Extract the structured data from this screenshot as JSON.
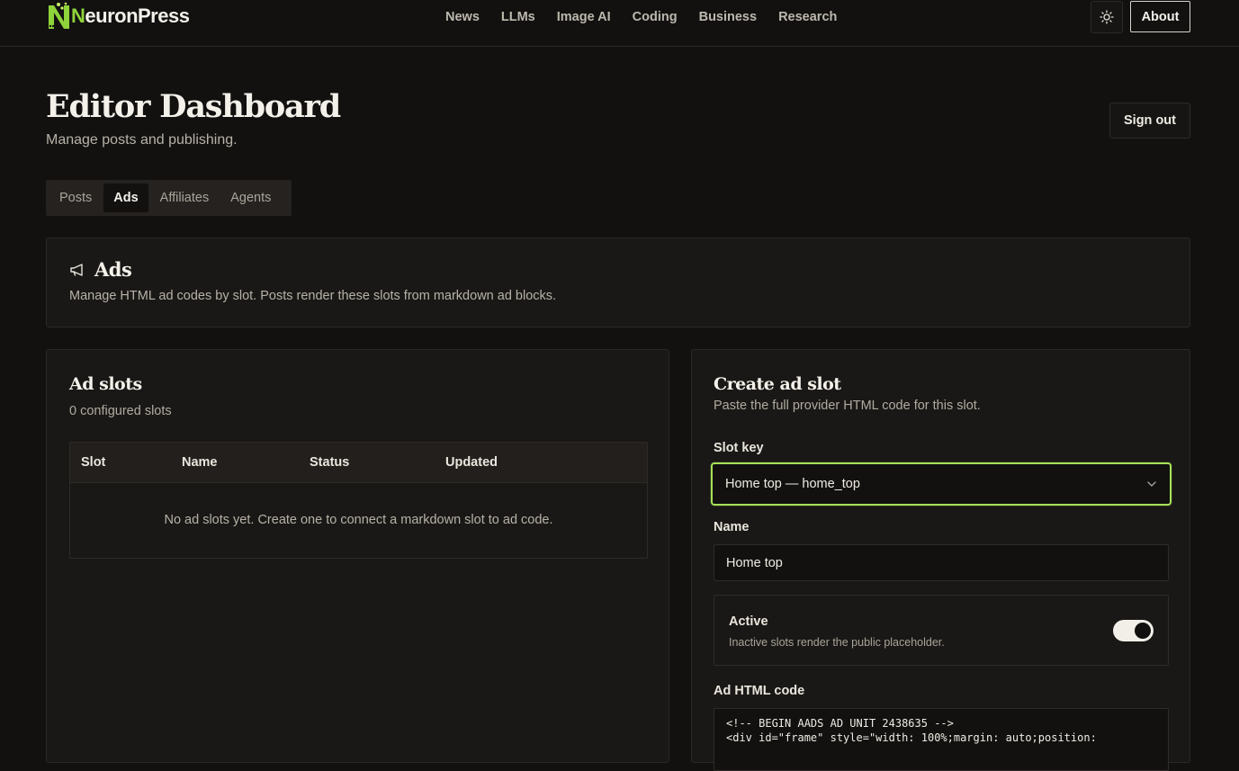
{
  "brand": {
    "name_first": "N",
    "name_rest": "euronPress"
  },
  "nav": {
    "links": [
      "News",
      "LLMs",
      "Image AI",
      "Coding",
      "Business",
      "Research"
    ],
    "theme_icon": "sun-icon",
    "about_label": "About"
  },
  "header": {
    "title": "Editor Dashboard",
    "subtitle": "Manage posts and publishing.",
    "signout_label": "Sign out"
  },
  "tabs": [
    {
      "label": "Posts",
      "active": false
    },
    {
      "label": "Ads",
      "active": true
    },
    {
      "label": "Affiliates",
      "active": false
    },
    {
      "label": "Agents",
      "active": false
    }
  ],
  "ads_section": {
    "icon": "megaphone-icon",
    "title": "Ads",
    "description": "Manage HTML ad codes by slot. Posts render these slots from markdown ad blocks."
  },
  "slots": {
    "title": "Ad slots",
    "count_text": "0 configured slots",
    "columns": [
      "Slot",
      "Name",
      "Status",
      "Updated"
    ],
    "empty_text": "No ad slots yet. Create one to connect a markdown slot to ad code."
  },
  "create": {
    "title": "Create ad slot",
    "subtitle": "Paste the full provider HTML code for this slot.",
    "slot_key_label": "Slot key",
    "slot_key_value": "Home top — home_top",
    "name_label": "Name",
    "name_value": "Home top",
    "active_label": "Active",
    "active_hint": "Inactive slots render the public placeholder.",
    "active_on": true,
    "code_label": "Ad HTML code",
    "code_lines": [
      "<!-- BEGIN AADS AD UNIT 2438635 -->",
      "<div id=\"frame\" style=\"width: 100%;margin: auto;position:"
    ]
  },
  "colors": {
    "accent": "#a7e05a",
    "logo_green": "#8fd33a",
    "background": "#121110"
  }
}
